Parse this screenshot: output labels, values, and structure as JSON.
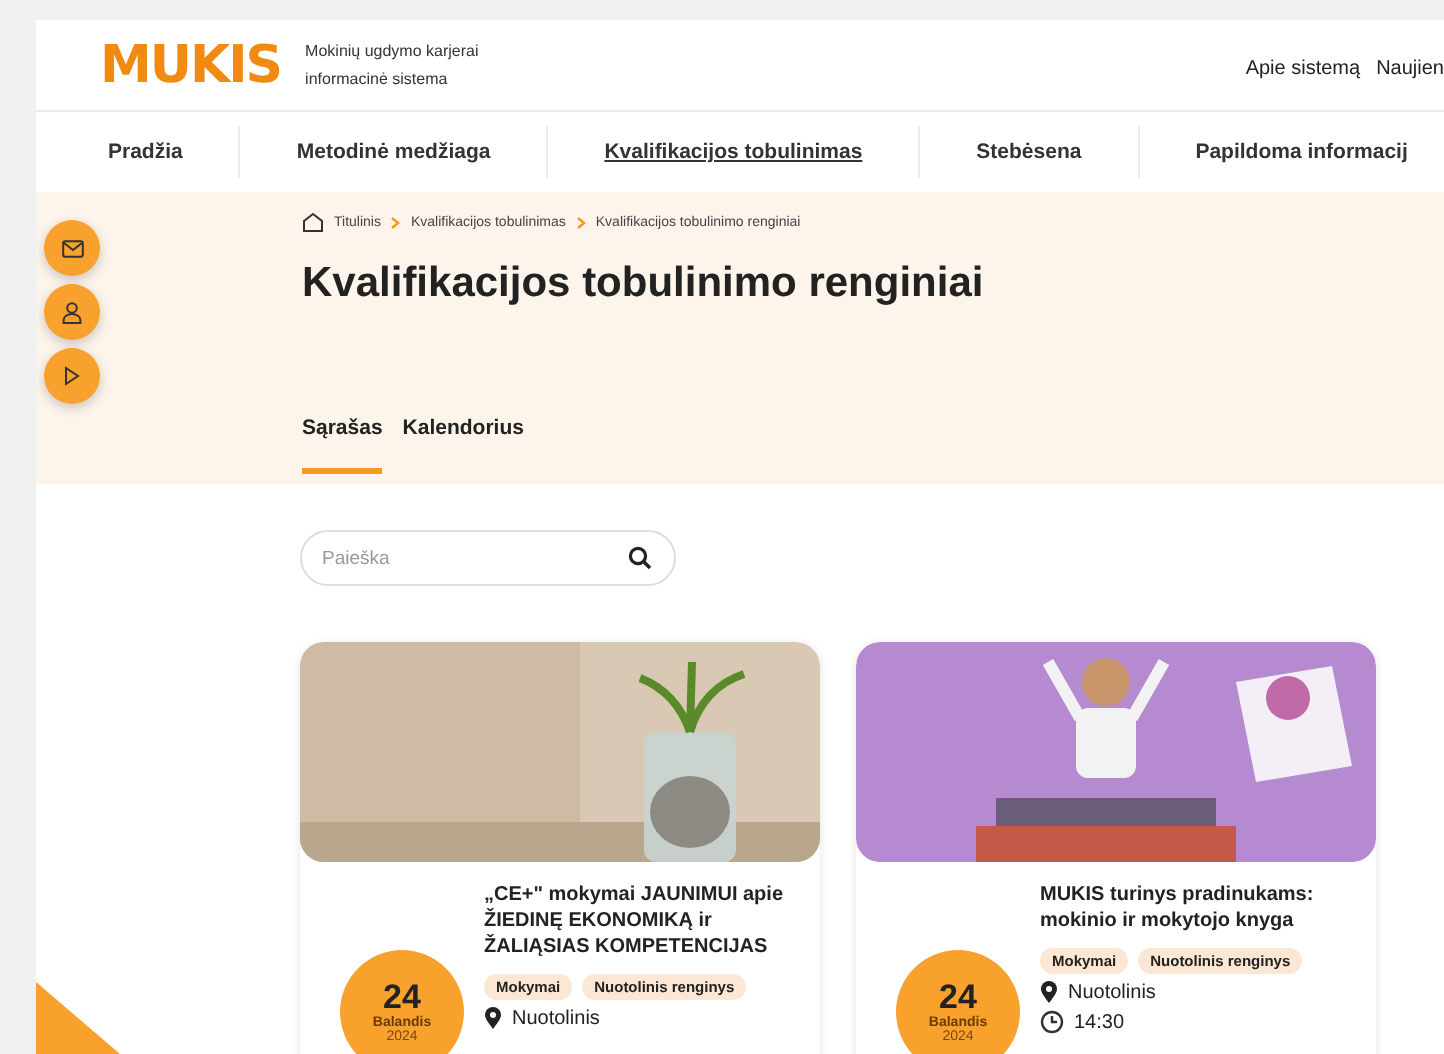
{
  "header": {
    "logo": "MUKIS",
    "tagline_1": "Mokinių ugdymo karjerai",
    "tagline_2": "informacinė sistema",
    "links": [
      "Apie sistemą",
      "Naujien"
    ]
  },
  "nav": [
    {
      "label": "Pradžia",
      "selected": false
    },
    {
      "label": "Metodinė medžiaga",
      "selected": false
    },
    {
      "label": "Kvalifikacijos tobulinimas",
      "selected": true
    },
    {
      "label": "Stebėsena",
      "selected": false
    },
    {
      "label": "Papildoma informacij",
      "selected": false
    }
  ],
  "breadcrumbs": [
    "Titulinis",
    "Kvalifikacijos tobulinimas",
    "Kvalifikacijos tobulinimo renginiai"
  ],
  "title": "Kvalifikacijos tobulinimo renginiai",
  "tabs": [
    {
      "label": "Sąrašas",
      "selected": true
    },
    {
      "label": "Kalendorius",
      "selected": false
    }
  ],
  "search": {
    "placeholder": "Paieška"
  },
  "cards": [
    {
      "kind": "plant",
      "title": "„CE+\" mokymai JAUNIMUI apie ŽIEDINĘ EKONOMIKĄ ir ŽALIĄSIAS KOMPETENCIJAS",
      "day": "24",
      "month": "Balandis",
      "year": "2024",
      "tags": [
        "Mokymai",
        "Nuotolinis renginys"
      ],
      "location": "Nuotolinis"
    },
    {
      "kind": "reading",
      "title": "MUKIS turinys pradinukams: mokinio ir mokytojo knyga",
      "day": "24",
      "month": "Balandis",
      "year": "2024",
      "tags": [
        "Mokymai",
        "Nuotolinis renginys"
      ],
      "location": "Nuotolinis",
      "time": "14:30"
    }
  ]
}
